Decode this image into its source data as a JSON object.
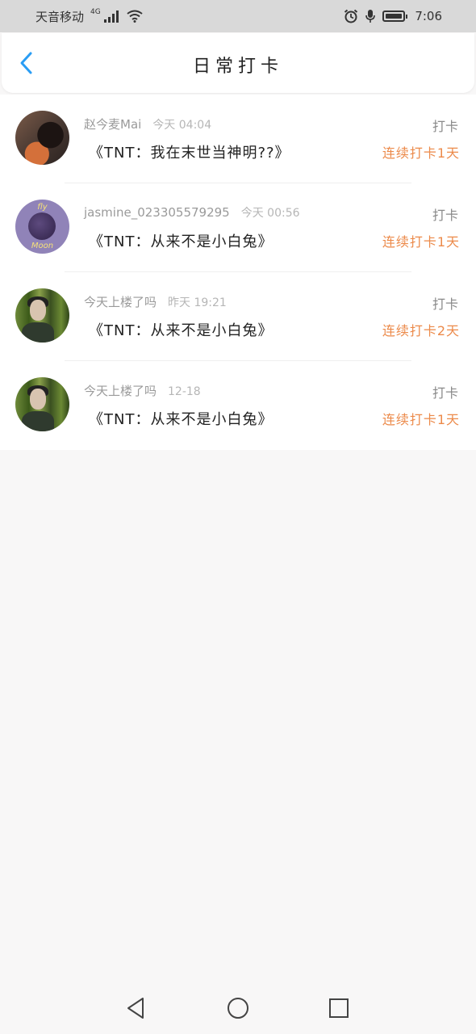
{
  "status_bar": {
    "carrier": "天音移动",
    "network_tag": "4G",
    "time": "7:06"
  },
  "header": {
    "title": "日常打卡"
  },
  "entries": [
    {
      "name": "赵今麦Mai",
      "time": "今天 04:04",
      "book": "《TNT：我在末世当神明??》",
      "action": "打卡",
      "streak": "连续打卡1天"
    },
    {
      "name": "jasmine_023305579295",
      "time": "今天 00:56",
      "book": "《TNT：从来不是小白兔》",
      "action": "打卡",
      "streak": "连续打卡1天"
    },
    {
      "name": "今天上楼了吗",
      "time": "昨天 19:21",
      "book": "《TNT：从来不是小白兔》",
      "action": "打卡",
      "streak": "连续打卡2天"
    },
    {
      "name": "今天上楼了吗",
      "time": "12-18",
      "book": "《TNT：从来不是小白兔》",
      "action": "打卡",
      "streak": "连续打卡1天"
    }
  ],
  "avatar_text": {
    "top": "fly",
    "bottom": "Moon"
  },
  "colors": {
    "accent_blue": "#2a9df4",
    "streak_orange": "#ec8a4a",
    "status_bar_bg": "#d9d9d9",
    "page_bg": "#f8f7f7"
  },
  "icons": {
    "back": "chevron-left-icon",
    "alarm": "alarm-icon",
    "mic": "microphone-icon",
    "battery": "battery-icon",
    "signal": "signal-icon",
    "wifi": "wifi-icon",
    "nav_back": "triangle-back-icon",
    "nav_home": "circle-home-icon",
    "nav_recent": "square-recent-icon"
  }
}
